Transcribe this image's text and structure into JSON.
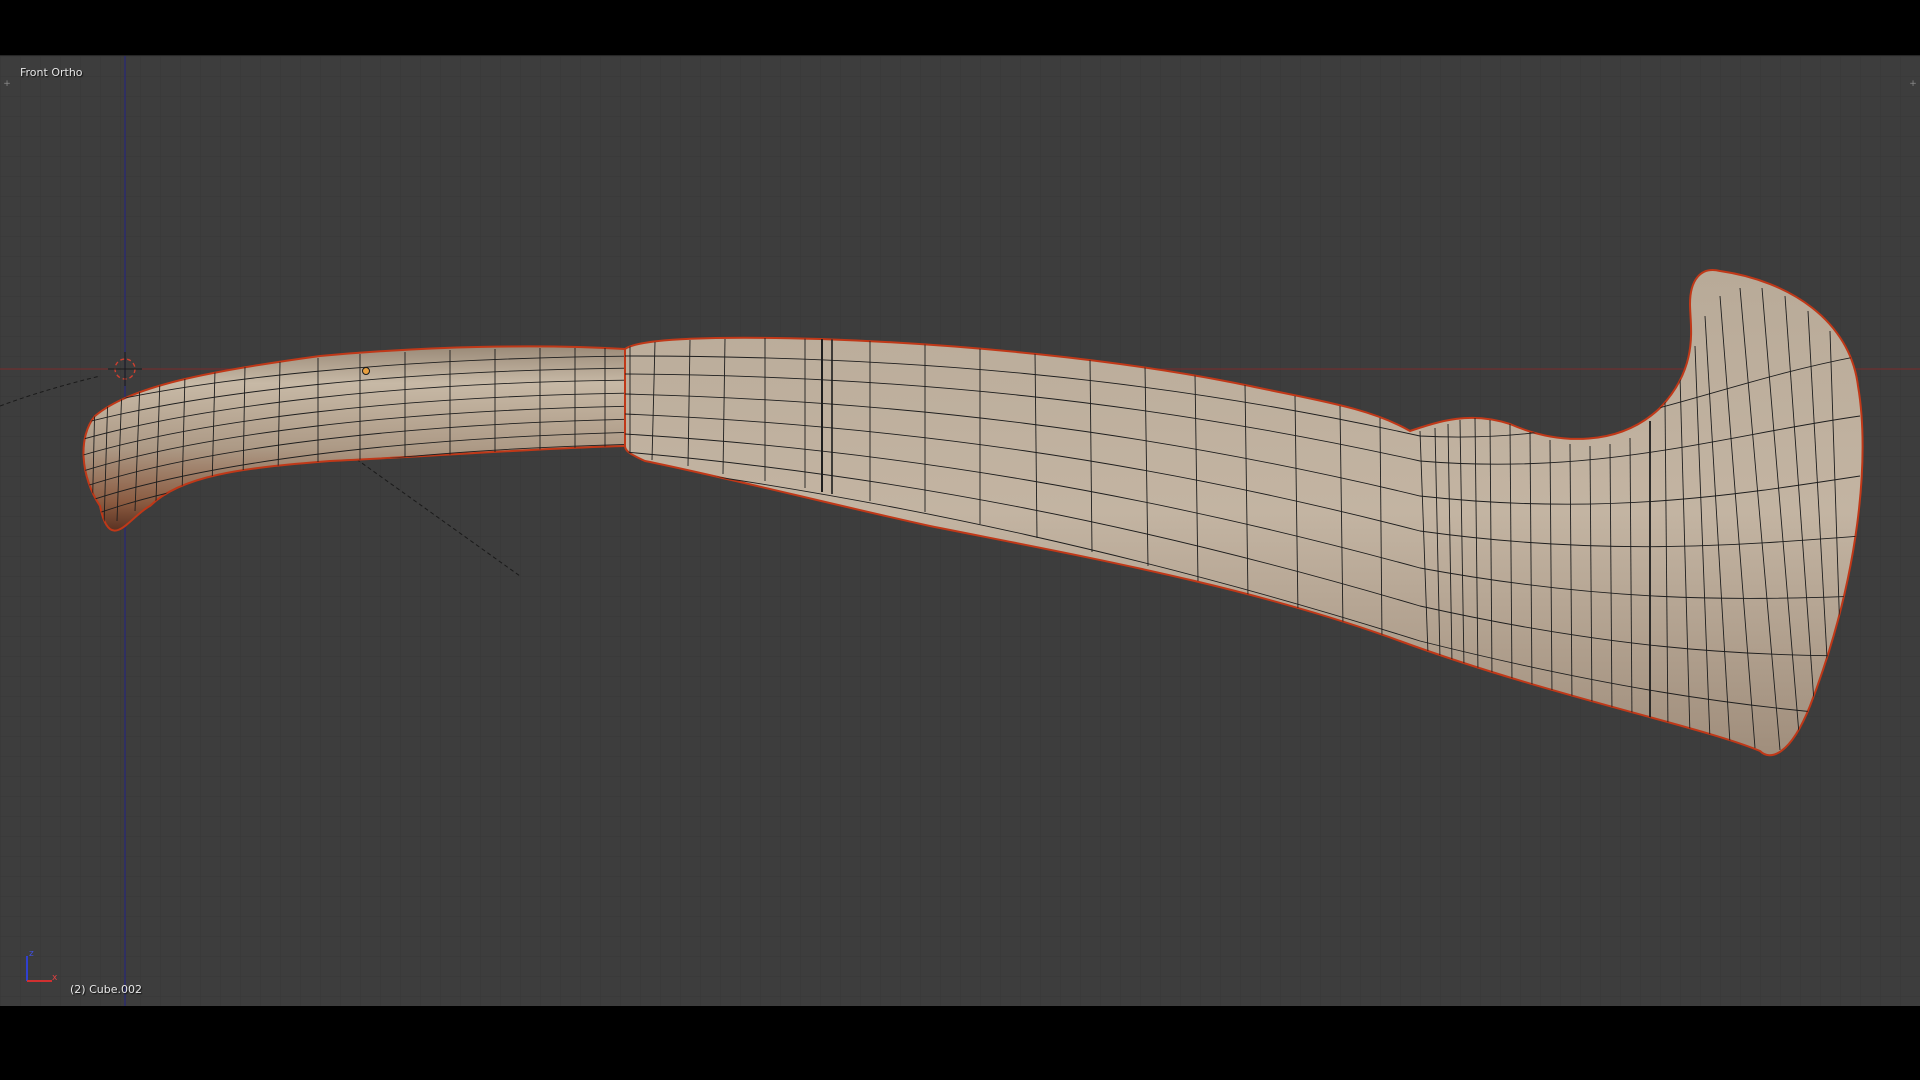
{
  "viewport": {
    "view_name": "Front Ortho",
    "active_object": "(2) Cube.002",
    "background_color": "#3d3d3d",
    "grid_color": "#363636",
    "x_axis_color": "#8a3030",
    "z_axis_color": "#2a2a8a",
    "mesh_color": "#c8b8a4",
    "wire_color": "#1a1a1a",
    "selection_outline_color": "#d04020"
  },
  "icons": {
    "corner_left": "plus-icon",
    "corner_right": "plus-icon",
    "axis_gizmo": "axis-gizmo-icon",
    "cursor_3d": "3d-cursor-icon",
    "object_origin": "origin-dot-icon"
  },
  "axis_gizmo": {
    "z_label": "z",
    "x_label": "x"
  }
}
